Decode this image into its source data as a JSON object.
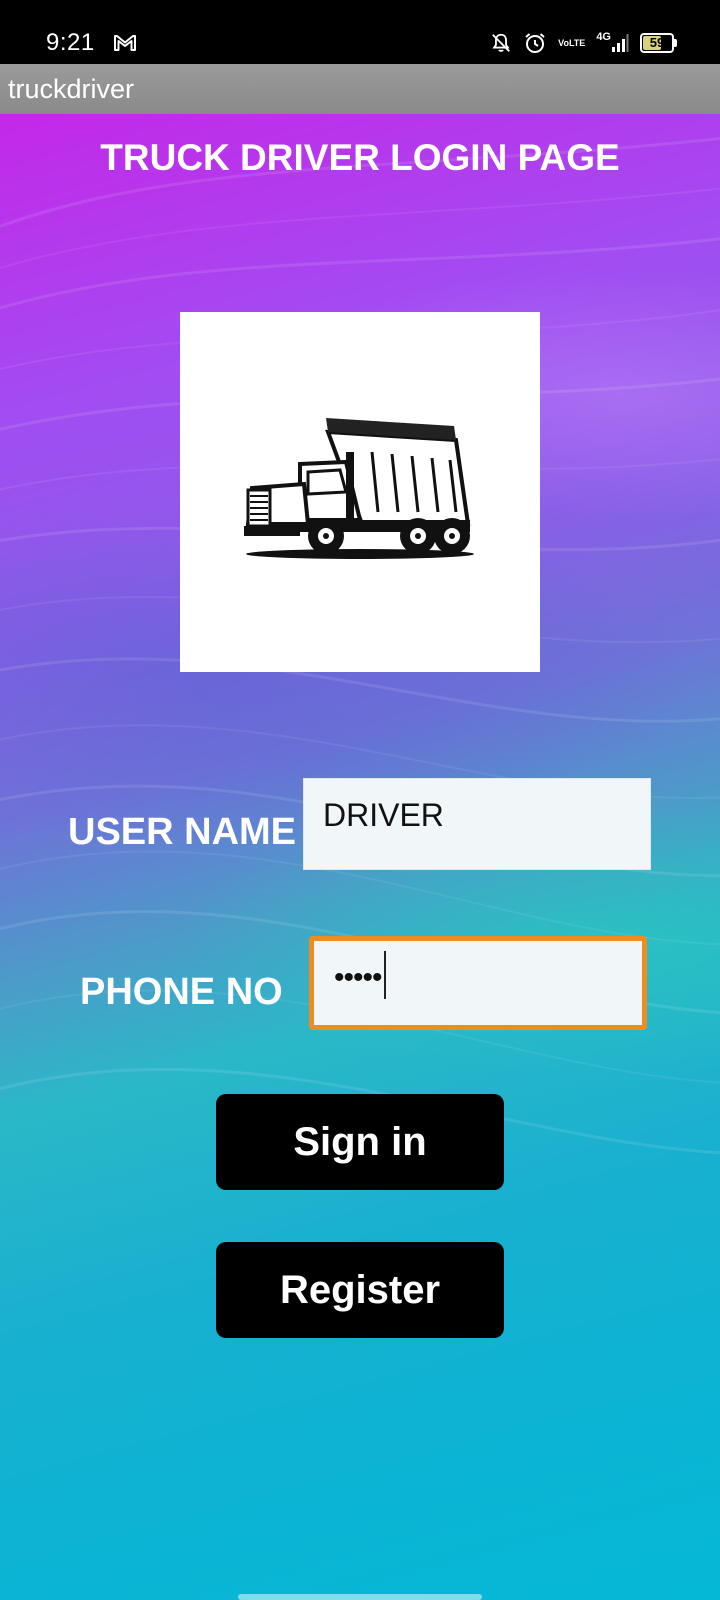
{
  "status_bar": {
    "time": "9:21",
    "battery": "59",
    "volte_top": "Vo",
    "volte_bottom": "LTE",
    "network": "4G"
  },
  "app": {
    "title": "truckdriver"
  },
  "login": {
    "page_title": "TRUCK DRIVER LOGIN PAGE",
    "username_label": "USER NAME",
    "username_value": "DRIVER",
    "phone_label": "PHONE NO",
    "phone_value_masked": "•••••",
    "signin_label": "Sign in",
    "register_label": "Register"
  },
  "colors": {
    "phone_focus_border": "#ee8d1f",
    "button_bg": "#000000",
    "field_bg": "#f1f7f8"
  },
  "icons": {
    "status": [
      "gmail-icon",
      "notifications-off-icon",
      "alarm-icon",
      "signal-icon",
      "battery-icon"
    ],
    "logo": "dump-truck-icon"
  }
}
